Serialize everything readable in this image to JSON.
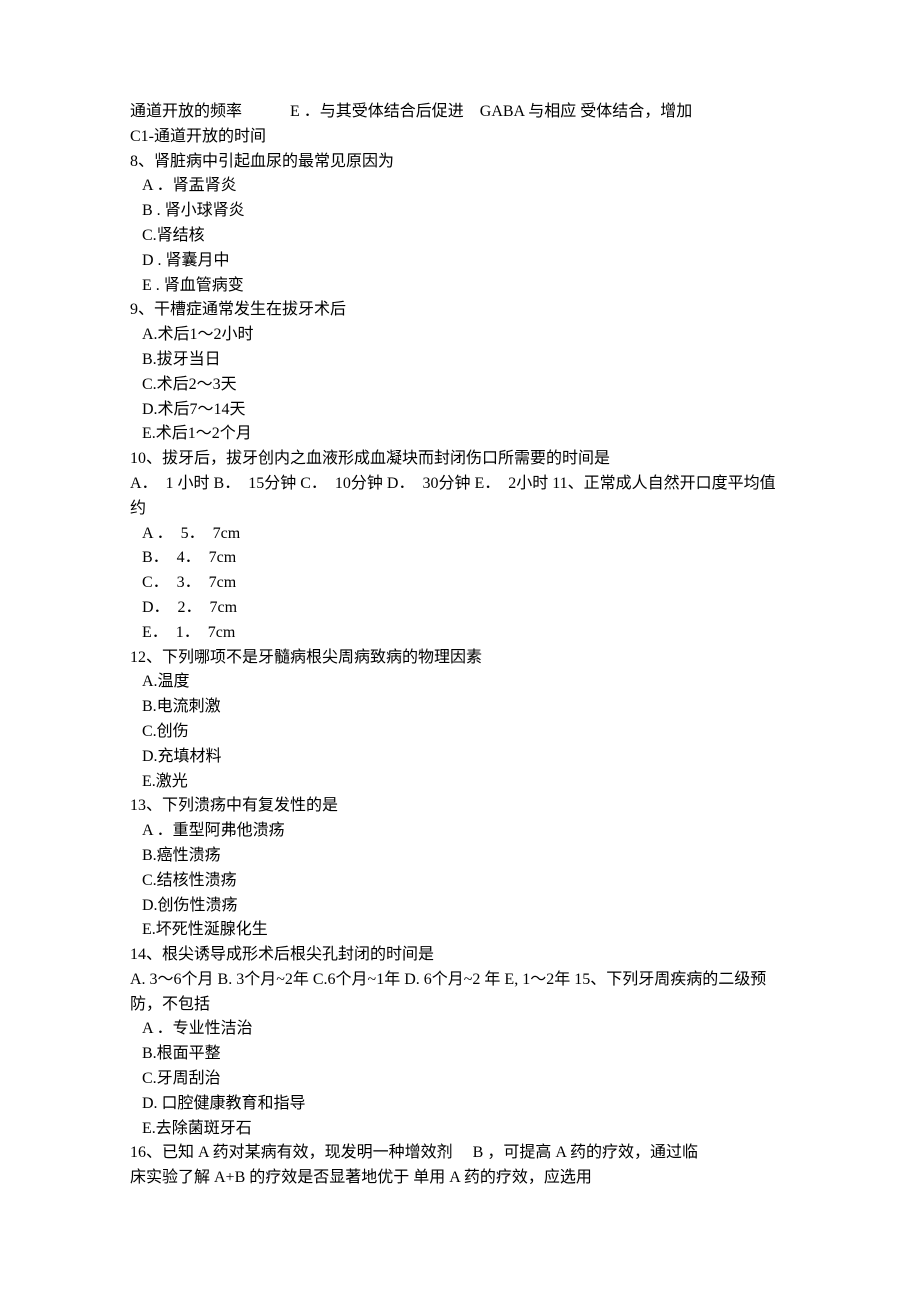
{
  "lines": [
    {
      "cls": "line",
      "text": "通道开放的频率　　　E ．与其受体结合后促进　GABA 与相应 受体结合，增加"
    },
    {
      "cls": "line",
      "text": "C1-通道开放的时间"
    },
    {
      "cls": "line",
      "text": "8、肾脏病中引起血尿的最常见原因为"
    },
    {
      "cls": "line indent1",
      "text": "A ．肾盂肾炎"
    },
    {
      "cls": "line indent1",
      "text": "B . 肾小球肾炎"
    },
    {
      "cls": "line indent1",
      "text": "C.肾结核"
    },
    {
      "cls": "line indent1",
      "text": "D . 肾囊月中"
    },
    {
      "cls": "line indent1",
      "text": "E . 肾血管病变"
    },
    {
      "cls": "line",
      "text": "9、干槽症通常发生在拔牙术后"
    },
    {
      "cls": "line indent1",
      "text": "A.术后1～2小时"
    },
    {
      "cls": "line indent1",
      "text": "B.拔牙当日"
    },
    {
      "cls": "line indent1",
      "text": "C.术后2～3天"
    },
    {
      "cls": "line indent1",
      "text": "D.术后7～14天"
    },
    {
      "cls": "line indent1",
      "text": "E.术后1～2个月"
    },
    {
      "cls": "line",
      "text": "10、拔牙后，拔牙创内之血液形成血凝块而封闭伤口所需要的时间是"
    },
    {
      "cls": "line",
      "text": " A．　1 小时  B．　15分钟  C．　10分钟  D．　30分钟  E．　2小时  11、正常成人自然开口度平均值约"
    },
    {
      "cls": "line indent1",
      "text": "A ．　5．　7cm"
    },
    {
      "cls": "line indent1",
      "text": "B．　4．　7cm"
    },
    {
      "cls": "line indent1",
      "text": "C．　3．　7cm"
    },
    {
      "cls": "line indent1",
      "text": "D．　2．　7cm"
    },
    {
      "cls": "line indent1",
      "text": "E．　1．　7cm"
    },
    {
      "cls": "line",
      "text": "12、下列哪项不是牙髓病根尖周病致病的物理因素"
    },
    {
      "cls": "line indent1",
      "text": "A.温度"
    },
    {
      "cls": "line indent1",
      "text": "B.电流刺激"
    },
    {
      "cls": "line indent1",
      "text": "C.创伤"
    },
    {
      "cls": "line indent1",
      "text": "D.充填材料"
    },
    {
      "cls": "line indent1",
      "text": "E.激光"
    },
    {
      "cls": "line",
      "text": "13、下列溃疡中有复发性的是"
    },
    {
      "cls": "line indent1",
      "text": "A ．重型阿弗他溃疡"
    },
    {
      "cls": "line indent1",
      "text": "B.癌性溃疡"
    },
    {
      "cls": "line indent1",
      "text": "C.结核性溃疡"
    },
    {
      "cls": "line indent1",
      "text": "D.创伤性溃疡"
    },
    {
      "cls": "line indent1",
      "text": "E.坏死性涎腺化生"
    },
    {
      "cls": "line",
      "text": "14、根尖诱导成形术后根尖孔封闭的时间是"
    },
    {
      "cls": "line",
      "text": " A. 3～6个月  B. 3个月~2年  C.6个月~1年  D. 6个月~2 年 E, 1～2年  15、下列牙周疾病的二级预防，不包括"
    },
    {
      "cls": "line indent1",
      "text": "A ．专业性洁治"
    },
    {
      "cls": "line indent1",
      "text": "B.根面平整"
    },
    {
      "cls": "line indent1",
      "text": "C.牙周刮治"
    },
    {
      "cls": "line indent1",
      "text": "D. 口腔健康教育和指导"
    },
    {
      "cls": "line indent1",
      "text": "E.去除菌斑牙石"
    },
    {
      "cls": "line",
      "text": "16、已知 A 药对某病有效，现发明一种增效剂　 B ，可提高 A 药的疗效，通过临"
    },
    {
      "cls": "line",
      "text": "床实验了解 A+B 的疗效是否显著地优于 单用 A 药的疗效，应选用"
    }
  ]
}
